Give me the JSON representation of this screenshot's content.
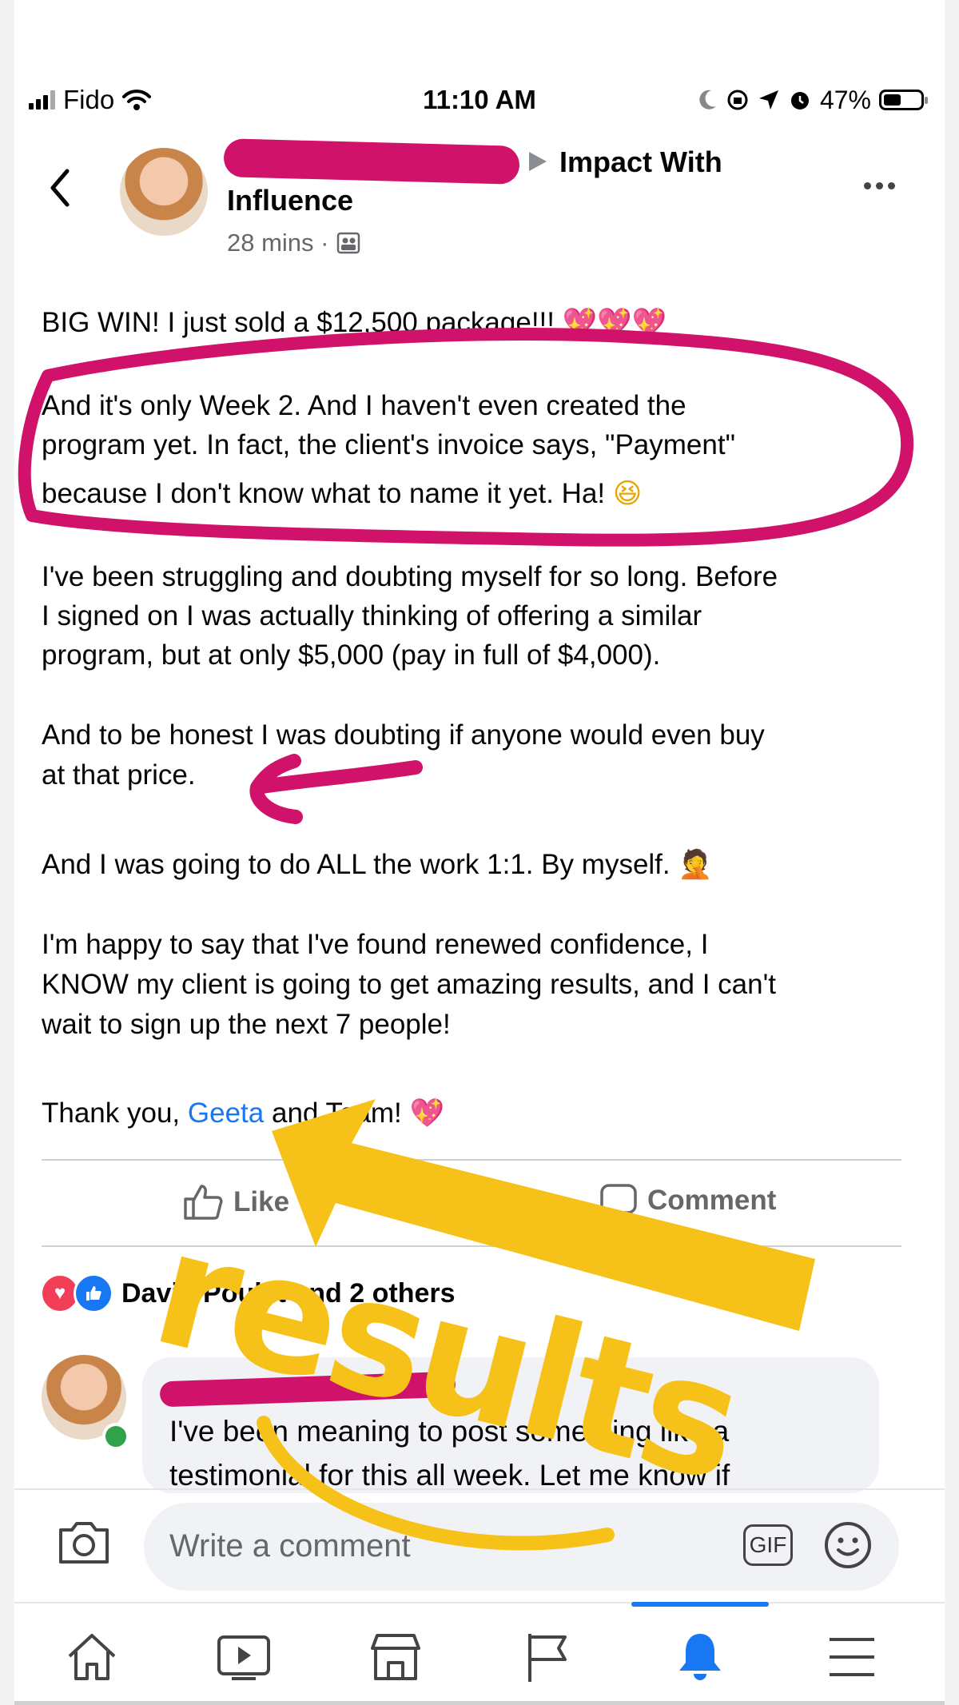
{
  "status_bar": {
    "carrier": "Fido",
    "time": "11:10 AM",
    "battery": "47%"
  },
  "post": {
    "group_line_1": "Impact With",
    "group_line_2": "Influence",
    "time_ago": "28 mins ·",
    "lines": [
      "BIG WIN! I just sold a $12,500 package!!!",
      "And it's only Week 2. And I haven't even created the",
      "program yet. In fact, the client's invoice says, \"Payment\"",
      "because I don't know what to name it yet. Ha!",
      "I've been struggling and doubting myself for so long. Before",
      "I signed on I was actually thinking of offering a similar",
      "program, but at only $5,000 (pay in full of $4,000).",
      "And to be honest I was doubting if anyone would even buy",
      "at that price.",
      "And I was going to do ALL the work 1:1. By myself.",
      "I'm happy to say that I've found renewed confidence, I",
      "KNOW my client is going to get amazing results, and I can't",
      "wait to sign up the next 7 people!"
    ],
    "thanks_prefix": "Thank you,",
    "mention": "Geeta",
    "thanks_suffix": "and Team!",
    "emoji_hearts": "💖💖💖",
    "emoji_laugh": "😆",
    "emoji_facepalm": "🤦",
    "emoji_heart": "💖"
  },
  "actions": {
    "like_label": "Like",
    "comment_label": "Comment"
  },
  "reactions": {
    "text": "David Poulet and 2 others"
  },
  "comment": {
    "line_1": "I've been meaning to post something like a",
    "line_2": "testimonial for this all week. Let me know if"
  },
  "composer": {
    "placeholder": "Write a comment",
    "gif_label": "GIF"
  },
  "overlay": {
    "sticker_text": "results",
    "pink": "#d0126a",
    "yellow": "#f6c21a"
  },
  "theme": {
    "fb_blue": "#1877f2",
    "muted": "#65676b"
  }
}
